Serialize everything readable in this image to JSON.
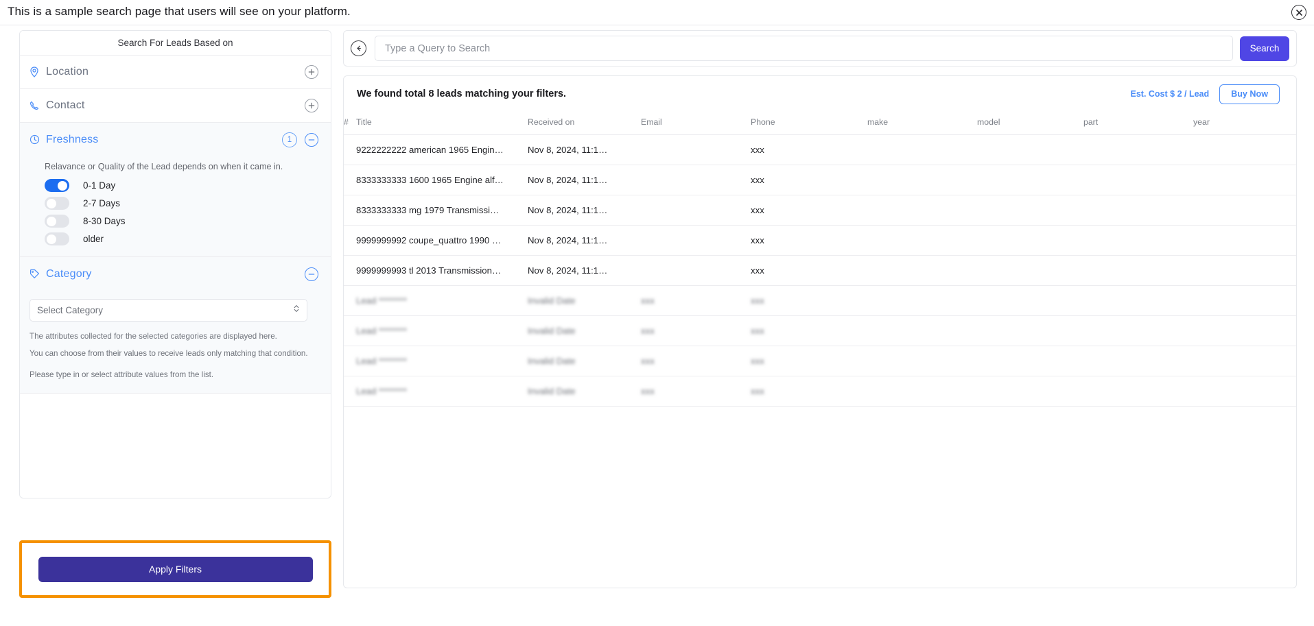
{
  "banner": {
    "text": "This is a sample search page that users will see on your platform.",
    "close_icon": "close-circle-icon"
  },
  "sidebar": {
    "title": "Search For Leads Based on",
    "filters": [
      {
        "label": "Location",
        "icon": "map-pin-icon",
        "state": "collapsed",
        "toggle_icon": "plus-circle-icon"
      },
      {
        "label": "Contact",
        "icon": "phone-icon",
        "state": "collapsed",
        "toggle_icon": "plus-circle-icon"
      },
      {
        "label": "Freshness",
        "icon": "clock-icon",
        "state": "expanded",
        "toggle_icon": "minus-circle-icon",
        "badge": "1"
      },
      {
        "label": "Category",
        "icon": "tag-icon",
        "state": "expanded",
        "toggle_icon": "minus-circle-icon"
      }
    ],
    "freshness": {
      "description": "Relavance or Quality of the Lead depends on when it came in.",
      "options": [
        {
          "label": "0-1 Day",
          "on": true
        },
        {
          "label": "2-7 Days",
          "on": false
        },
        {
          "label": "8-30 Days",
          "on": false
        },
        {
          "label": "older",
          "on": false
        }
      ]
    },
    "category": {
      "select_placeholder": "Select Category",
      "select_icon": "chevron-updown-icon",
      "hints": [
        "The attributes collected for the selected categories are displayed here.",
        "You can choose from their values to receive leads only matching that condition.",
        "Please type in or select attribute values from the list."
      ]
    },
    "apply_label": "Apply Filters",
    "highlight_color": "#f59100"
  },
  "search": {
    "back_icon": "back-arrow-circle-icon",
    "placeholder": "Type a Query to Search",
    "value": "",
    "button_label": "Search",
    "button_color": "#4f46e5"
  },
  "results": {
    "summary": "We found total 8 leads matching your filters.",
    "est_cost": "Est. Cost $ 2 / Lead",
    "buy_label": "Buy Now",
    "accent_color": "#4b8df8",
    "columns": [
      "#",
      "Title",
      "Received on",
      "Email",
      "Phone",
      "make",
      "model",
      "part",
      "year"
    ],
    "rows": [
      {
        "title": "9222222222 american 1965 Engin…",
        "received": "Nov 8, 2024, 11:1…",
        "email": "",
        "phone": "xxx",
        "make": "",
        "model": "",
        "part": "",
        "year": "",
        "blurred": false
      },
      {
        "title": "8333333333 1600 1965 Engine alf…",
        "received": "Nov 8, 2024, 11:1…",
        "email": "",
        "phone": "xxx",
        "make": "",
        "model": "",
        "part": "",
        "year": "",
        "blurred": false
      },
      {
        "title": "8333333333 mg 1979 Transmissi…",
        "received": "Nov 8, 2024, 11:1…",
        "email": "",
        "phone": "xxx",
        "make": "",
        "model": "",
        "part": "",
        "year": "",
        "blurred": false
      },
      {
        "title": "9999999992 coupe_quattro 1990 …",
        "received": "Nov 8, 2024, 11:1…",
        "email": "",
        "phone": "xxx",
        "make": "",
        "model": "",
        "part": "",
        "year": "",
        "blurred": false
      },
      {
        "title": "9999999993 tl 2013 Transmission…",
        "received": "Nov 8, 2024, 11:1…",
        "email": "",
        "phone": "xxx",
        "make": "",
        "model": "",
        "part": "",
        "year": "",
        "blurred": false
      },
      {
        "title": "Lead ********",
        "received": "Invalid Date",
        "email": "xxx",
        "phone": "xxx",
        "make": "",
        "model": "",
        "part": "",
        "year": "",
        "blurred": true
      },
      {
        "title": "Lead ********",
        "received": "Invalid Date",
        "email": "xxx",
        "phone": "xxx",
        "make": "",
        "model": "",
        "part": "",
        "year": "",
        "blurred": true
      },
      {
        "title": "Lead ********",
        "received": "Invalid Date",
        "email": "xxx",
        "phone": "xxx",
        "make": "",
        "model": "",
        "part": "",
        "year": "",
        "blurred": true
      },
      {
        "title": "Lead ********",
        "received": "Invalid Date",
        "email": "xxx",
        "phone": "xxx",
        "make": "",
        "model": "",
        "part": "",
        "year": "",
        "blurred": true
      }
    ]
  }
}
